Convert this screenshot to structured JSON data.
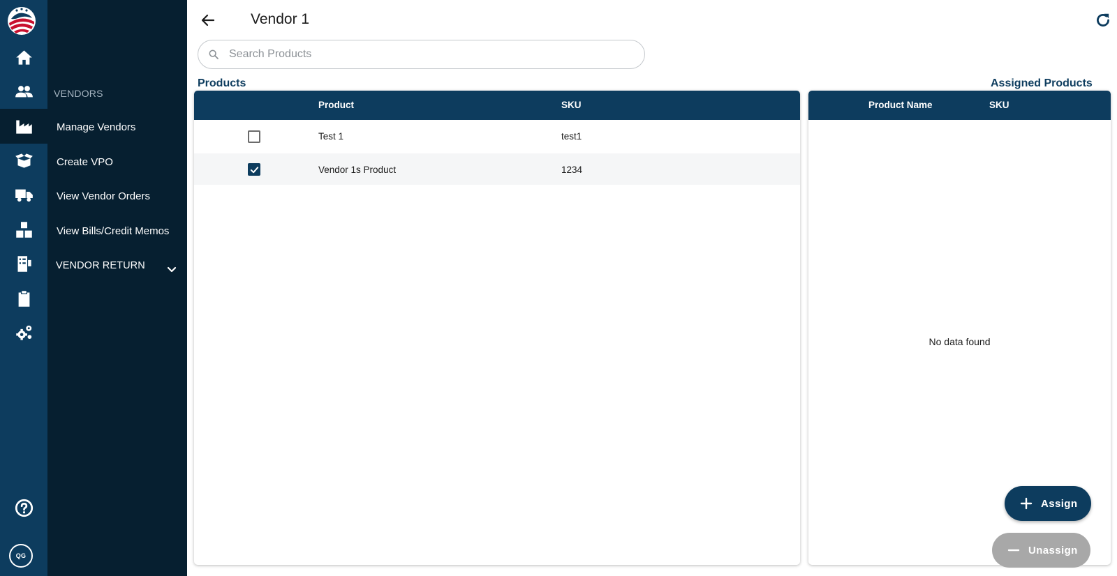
{
  "rail": {
    "icons": [
      "home-icon",
      "users-icon",
      "factory-icon",
      "open-box-icon",
      "truck-icon",
      "boxes-icon",
      "receipt-icon",
      "clipboard-icon",
      "gears-icon",
      "help-icon"
    ],
    "avatar_initials": "QG"
  },
  "menu": {
    "heading": "VENDORS",
    "items": [
      {
        "label": "Manage Vendors"
      },
      {
        "label": "Create VPO"
      },
      {
        "label": "View Vendor Orders"
      },
      {
        "label": "View Bills/Credit Memos"
      },
      {
        "label": "VENDOR RETURN"
      }
    ]
  },
  "header": {
    "title": "Vendor 1"
  },
  "search": {
    "placeholder": "Search Products",
    "value": ""
  },
  "products": {
    "label": "Products",
    "columns": [
      "Product",
      "SKU"
    ],
    "rows": [
      {
        "product": "Test 1",
        "sku": "test1",
        "checked": false
      },
      {
        "product": "Vendor 1s Product",
        "sku": "1234",
        "checked": true
      }
    ]
  },
  "assigned": {
    "label": "Assigned Products",
    "columns": [
      "Product Name",
      "SKU"
    ],
    "empty_text": "No data found"
  },
  "actions": {
    "assign_label": "Assign",
    "unassign_label": "Unassign"
  },
  "colors": {
    "primary": "#0d3c5e",
    "menu_bg": "#061f30",
    "disabled": "#a8a8a8"
  }
}
